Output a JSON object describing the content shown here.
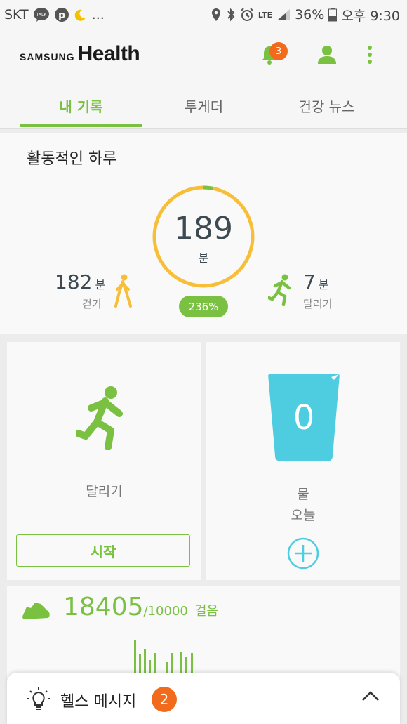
{
  "status_bar": {
    "carrier": "SKT",
    "talk_icon_text": "TALK",
    "lte": "LTE",
    "battery": "36%",
    "time": "오후 9:30",
    "dots": "..."
  },
  "header": {
    "brand_small": "SAMSUNG",
    "brand_large": "Health",
    "notification_count": "3"
  },
  "tabs": [
    {
      "label": "내 기록",
      "active": true
    },
    {
      "label": "투게더",
      "active": false
    },
    {
      "label": "건강 뉴스",
      "active": false
    }
  ],
  "active_day": {
    "title": "활동적인 하루",
    "total_value": "189",
    "total_unit": "분",
    "percent": "236%",
    "walking": {
      "value": "182",
      "unit": "분",
      "label": "걷기"
    },
    "running": {
      "value": "7",
      "unit": "분",
      "label": "달리기"
    },
    "ring_progress": 0.03,
    "colors": {
      "ring": "#f7be3a",
      "accent": "#7ac142"
    }
  },
  "running_tile": {
    "label": "달리기",
    "button": "시작"
  },
  "water_tile": {
    "count": "0",
    "label": "물",
    "sublabel": "오늘",
    "color": "#4fcde0"
  },
  "steps": {
    "value": "18405",
    "goal": "/10000",
    "unit": "걸음"
  },
  "health_message": {
    "label": "헬스 메시지",
    "count": "2"
  }
}
